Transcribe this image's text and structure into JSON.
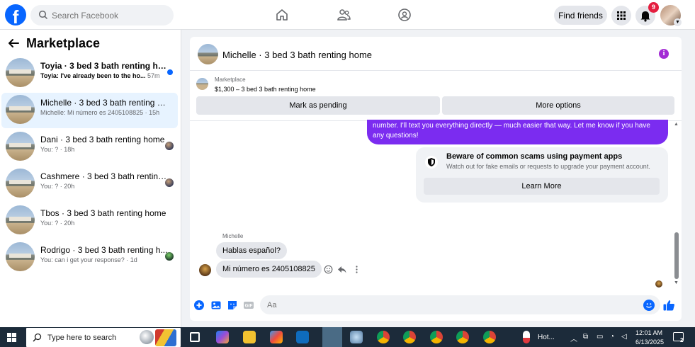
{
  "topbar": {
    "logo_letter": "f",
    "search_placeholder": "Search Facebook",
    "find_friends_label": "Find friends",
    "notification_count": "9",
    "nav_icons": [
      "home-icon",
      "friends-icon",
      "groups-icon"
    ],
    "colors": {
      "brand": "#0866ff",
      "badge": "#e41e3f"
    }
  },
  "sidebar": {
    "title": "Marketplace",
    "conversations": [
      {
        "name": "Toyia · 3 bed 3 bath renting home",
        "preview": "Toyia: I've already been to the ho...",
        "time": "57m",
        "unread": true
      },
      {
        "name": "Michelle · 3 bed 3 bath renting ho...",
        "preview": "Michelle: Mi número es 2405108825 ·",
        "time": "15h",
        "active": true
      },
      {
        "name": "Dani · 3 bed 3 bath renting home",
        "preview": "You: ? ·",
        "time": "18h"
      },
      {
        "name": "Cashmere · 3 bed 3 bath renting...",
        "preview": "You: ? ·",
        "time": "20h"
      },
      {
        "name": "Tbos · 3 bed 3 bath renting home",
        "preview": "You: ? ·",
        "time": "20h"
      },
      {
        "name": "Rodrigo · 3 bed 3 bath renting h...",
        "preview": "You: can i get your response? ·",
        "time": "1d"
      }
    ]
  },
  "chat": {
    "title": "Michelle · 3 bed 3 bath renting home",
    "listing": {
      "source": "Marketplace",
      "summary": "$1,300 – 3 bed 3 bath renting home"
    },
    "actions": {
      "mark_pending": "Mark as pending",
      "more_options": "More options"
    },
    "outgoing_message": "number. I'll text you everything directly — much easier that way. Let me know if you have any questions!",
    "warning": {
      "title": "Beware of common scams using payment apps",
      "text": "Watch out for fake emails or requests to upgrade your payment account.",
      "button": "Learn More"
    },
    "sender_name": "Michelle",
    "incoming": [
      "Hablas español?",
      "Mi número es 2405108825"
    ],
    "composer_placeholder": "Aa",
    "colors": {
      "outgoing_bubble": "#7b2cf0",
      "info": "#a32cd4"
    }
  },
  "taskbar": {
    "search_placeholder": "Type here to search",
    "weather": "Hot...",
    "time": "12:01 AM",
    "date": "6/13/2025",
    "notification_count": "2"
  }
}
